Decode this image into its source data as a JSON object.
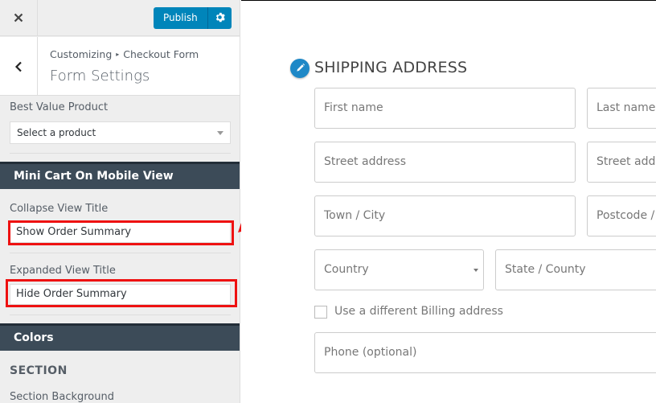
{
  "header": {
    "close_label": "×",
    "publish_label": "Publish",
    "breadcrumb_root": "Customizing",
    "breadcrumb_sep": "▸",
    "breadcrumb_current": "Checkout Form",
    "panel_title": "Form Settings"
  },
  "sidebar": {
    "best_value": {
      "label": "Best Value Product",
      "selected": "Select a product"
    },
    "mini_cart": {
      "heading": "Mini Cart On Mobile View",
      "collapse_label": "Collapse View Title",
      "collapse_value": "Show Order Summary",
      "expanded_label": "Expanded View Title",
      "expanded_value": "Hide Order Summary"
    },
    "colors": {
      "heading": "Colors",
      "subheading": "SECTION",
      "section_background_label": "Section Background"
    }
  },
  "preview": {
    "section_title": "SHIPPING ADDRESS",
    "fields": {
      "first_name": "First name",
      "last_name": "Last name",
      "street_address": "Street address",
      "street_address_2": "Street addr",
      "town_city": "Town / City",
      "postcode": "Postcode / Z",
      "country": "Country",
      "state_county": "State / County",
      "phone": "Phone (optional)"
    },
    "billing_checkbox_label": "Use a different Billing address",
    "billing_checkbox_checked": false
  },
  "colors": {
    "accent": "#0085ba",
    "section_header": "#3c4b58",
    "annotation_red": "#ee1111",
    "icon_blue": "#1e88c7"
  }
}
